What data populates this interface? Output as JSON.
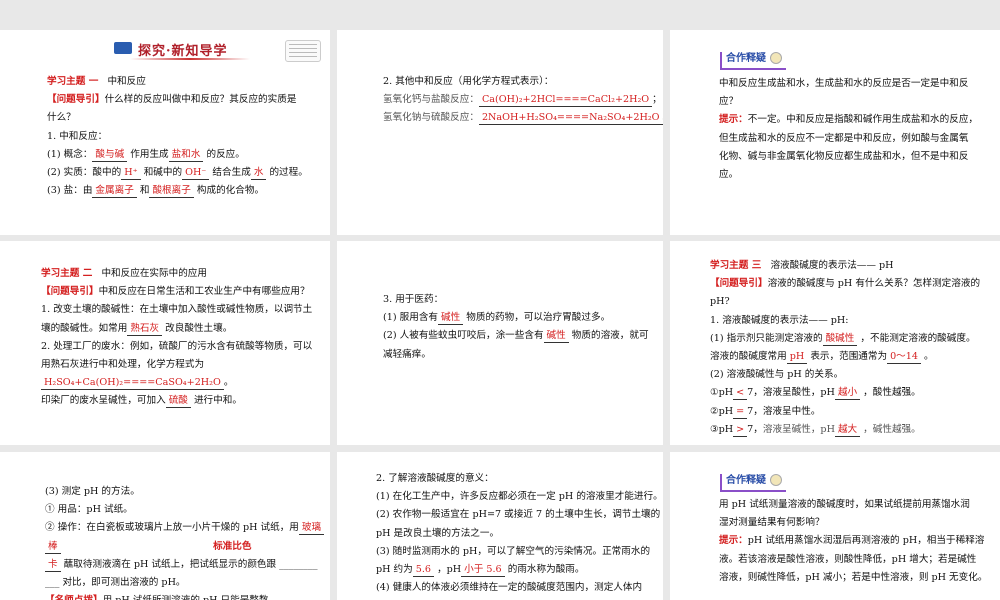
{
  "header": {
    "title": "探究·新知导学"
  },
  "coop_tag": "合作释疑",
  "panels": [
    {
      "id": "p1",
      "lines": [
        [
          [
            "red",
            "学习主题 一"
          ],
          [
            "t",
            "   中和反应"
          ]
        ],
        [
          [
            "red",
            "【问题导引】"
          ],
          [
            "t",
            "什么样的反应叫做中和反应？其反应的实质是"
          ]
        ],
        [
          [
            "t",
            "什么？"
          ]
        ],
        [
          [
            "t",
            "1. 中和反应："
          ]
        ],
        [
          [
            "t",
            "(1) 概念："
          ],
          [
            "f",
            "酸与碱"
          ],
          [
            "t",
            " 作用生成"
          ],
          [
            "f",
            "盐和水"
          ],
          [
            "t",
            " 的反应。"
          ]
        ],
        [
          [
            "t",
            "(2) 实质：酸中的"
          ],
          [
            "f",
            "H⁺"
          ],
          [
            "t",
            " 和碱中的"
          ],
          [
            "f",
            "OH⁻"
          ],
          [
            "t",
            " 结合生成"
          ],
          [
            "f",
            "水"
          ],
          [
            "t",
            " 的过程。"
          ]
        ],
        [
          [
            "t",
            "(3) 盐：由"
          ],
          [
            "f",
            "金属离子"
          ],
          [
            "t",
            " 和"
          ],
          [
            "f",
            "酸根离子"
          ],
          [
            "t",
            " 构成的化合物。"
          ]
        ]
      ]
    },
    {
      "id": "p2",
      "lines": [
        [
          [
            "t",
            "2. 其他中和反应（用化学方程式表示）："
          ]
        ],
        [
          [
            "g",
            "氢氧化钙与盐酸反应："
          ],
          [
            "f",
            "Ca(OH)₂+2HCl====CaCl₂+2H₂O"
          ],
          [
            "t",
            "；"
          ]
        ],
        [
          [
            "g",
            "氢氧化钠与硫酸反应："
          ],
          [
            "f",
            "2NaOH+H₂SO₄====Na₂SO₄+2H₂O"
          ],
          [
            "t",
            "。"
          ]
        ]
      ]
    },
    {
      "id": "p3",
      "lines": [
        [
          [
            "t",
            "中和反应生成盐和水，生成盐和水的反应是否一定是中和反"
          ]
        ],
        [
          [
            "t",
            "应？"
          ]
        ],
        [
          [
            "red",
            "提示："
          ],
          [
            "t",
            "不一定。中和反应是指酸和碱作用生成盐和水的反应，"
          ]
        ],
        [
          [
            "t",
            "但生成盐和水的反应不一定都是中和反应，例如酸与金属氧"
          ]
        ],
        [
          [
            "t",
            "化物、碱与非金属氧化物反应都生成盐和水，但不是中和反"
          ]
        ],
        [
          [
            "t",
            "应。"
          ]
        ]
      ]
    },
    {
      "id": "p4",
      "lines": [
        [
          [
            "red",
            "学习主题 二"
          ],
          [
            "t",
            "   中和反应在实际中的应用"
          ]
        ],
        [
          [
            "red",
            "【问题导引】"
          ],
          [
            "t",
            "中和反应在日常生活和工农业生产中有哪些应用？"
          ]
        ],
        [
          [
            "t",
            "1. 改变土壤的酸碱性：在土壤中加入酸性或碱性物质，以调节土"
          ]
        ],
        [
          [
            "t",
            "壤的酸碱性。如常用"
          ],
          [
            "f",
            "熟石灰"
          ],
          [
            "t",
            " 改良酸性土壤。"
          ]
        ],
        [
          [
            "t",
            "2. 处理工厂的废水：例如，硫酸厂的污水含有硫酸等物质，可以"
          ]
        ],
        [
          [
            "t",
            "用熟石灰进行中和处理，化学方程式为"
          ]
        ],
        [
          [
            "f",
            "H₂SO₄+Ca(OH)₂====CaSO₄+2H₂O"
          ],
          [
            "t",
            "。"
          ]
        ],
        [
          [
            "t",
            "印染厂的废水呈碱性，可加入"
          ],
          [
            "f",
            "硫酸"
          ],
          [
            "t",
            " 进行中和。"
          ]
        ]
      ]
    },
    {
      "id": "p5",
      "lines": [
        [
          [
            "t",
            "3. 用于医药："
          ]
        ],
        [
          [
            "t",
            "(1) 服用含有"
          ],
          [
            "f",
            "碱性"
          ],
          [
            "t",
            " 物质的药物，可以治疗胃酸过多。"
          ]
        ],
        [
          [
            "t",
            "(2) 人被有些蚊虫叮咬后，涂一些含有"
          ],
          [
            "f",
            "碱性"
          ],
          [
            "t",
            " 物质的溶液，就可"
          ]
        ],
        [
          [
            "t",
            "减轻痛痒。"
          ]
        ]
      ]
    },
    {
      "id": "p6",
      "lines": [
        [
          [
            "red",
            "学习主题 三"
          ],
          [
            "t",
            "   溶液酸碱度的表示法—— pH"
          ]
        ],
        [
          [
            "red",
            "【问题导引】"
          ],
          [
            "t",
            "溶液的酸碱度与 pH 有什么关系？怎样测定溶液的"
          ]
        ],
        [
          [
            "t",
            "pH?"
          ]
        ],
        [
          [
            "t",
            "1. 溶液酸碱度的表示法—— pH:"
          ]
        ],
        [
          [
            "t",
            "(1) 指示剂只能测定溶液的"
          ],
          [
            "f",
            "酸碱性"
          ],
          [
            "t",
            " ，不能测定溶液的酸碱度。"
          ]
        ],
        [
          [
            "t",
            "溶液的酸碱度常用"
          ],
          [
            "f",
            "pH"
          ],
          [
            "t",
            " 表示，范围通常为"
          ],
          [
            "f",
            "0～14"
          ],
          [
            "t",
            " 。"
          ]
        ],
        [
          [
            "t",
            "(2) 溶液酸碱性与 pH 的关系。"
          ]
        ],
        [
          [
            "t",
            "①pH"
          ],
          [
            "f",
            "<"
          ],
          [
            "t",
            "7，溶液呈酸性，pH"
          ],
          [
            "f",
            "越小"
          ],
          [
            "t",
            " ，酸性越强。"
          ]
        ],
        [
          [
            "t",
            "②pH"
          ],
          [
            "f",
            "="
          ],
          [
            "t",
            "7，溶液呈中性。"
          ]
        ],
        [
          [
            "t",
            "③pH"
          ],
          [
            "f",
            ">"
          ],
          [
            "t",
            "7，"
          ],
          [
            "g",
            "溶液呈碱性，pH"
          ],
          [
            "f",
            "越大"
          ],
          [
            "g",
            " ，碱性越强。"
          ]
        ]
      ]
    },
    {
      "id": "p7",
      "lines": [
        [
          [
            "t",
            "(3) 测定 pH 的方法。"
          ]
        ],
        [
          [
            "t",
            "① 用品：pH 试纸。"
          ]
        ],
        [
          [
            "t",
            "② 操作：在白瓷板或玻璃片上放一小片干燥的 pH 试纸，用"
          ],
          [
            "f",
            "玻璃"
          ]
        ],
        [
          [
            "f",
            "棒"
          ],
          [
            "t",
            "                                                  "
          ],
          [
            "red",
            "标准比色"
          ]
        ],
        [
          [
            "f",
            "卡"
          ],
          [
            "t",
            " 蘸取待测液滴在 pH 试纸上，把试纸显示的颜色跟 ________"
          ]
        ],
        [
          [
            "t",
            "___ 对比，即可测出溶液的 pH。"
          ]
        ],
        [
          [
            "red",
            "【名师点拨】"
          ],
          [
            "t",
            "用 pH 试纸所测溶液的 pH 只能是整数"
          ]
        ]
      ]
    },
    {
      "id": "p8",
      "lines": [
        [
          [
            "t",
            "2. 了解溶液酸碱度的意义："
          ]
        ],
        [
          [
            "t",
            "(1) 在化工生产中，许多反应都必须在一定 pH 的溶液里才能进行。"
          ]
        ],
        [
          [
            "t",
            "(2) 农作物一般适宜在 pH=7 或接近 7 的土壤中生长，调节土壤的"
          ]
        ],
        [
          [
            "t",
            "pH 是改良土壤的方法之一。"
          ]
        ],
        [
          [
            "t",
            "(3) 随时监测雨水的 pH，可以了解空气的污染情况。正常雨水的"
          ]
        ],
        [
          [
            "t",
            "pH 约为"
          ],
          [
            "f",
            "5.6"
          ],
          [
            "t",
            " ，pH"
          ],
          [
            "f",
            "小于 5.6"
          ],
          [
            "t",
            " 的雨水称为酸雨。"
          ]
        ],
        [
          [
            "t",
            "(4) 健康人的体液必须维持在一定的酸碱度范围内，测定人体内"
          ]
        ]
      ]
    },
    {
      "id": "p9",
      "lines": [
        [
          [
            "t",
            "用 pH 试纸测量溶液的酸碱度时，如果试纸提前用蒸馏水润"
          ]
        ],
        [
          [
            "t",
            "湿对测量结果有何影响？"
          ]
        ],
        [
          [
            "red",
            "提示："
          ],
          [
            "t",
            "pH 试纸用蒸馏水润湿后再测溶液的 pH，相当于稀释溶"
          ]
        ],
        [
          [
            "t",
            "液。若该溶液是酸性溶液，则酸性降低，pH 增大；若是碱性"
          ]
        ],
        [
          [
            "t",
            "溶液，则碱性降低，pH 减小；若是中性溶液，则 pH 无变化。"
          ]
        ]
      ]
    }
  ]
}
